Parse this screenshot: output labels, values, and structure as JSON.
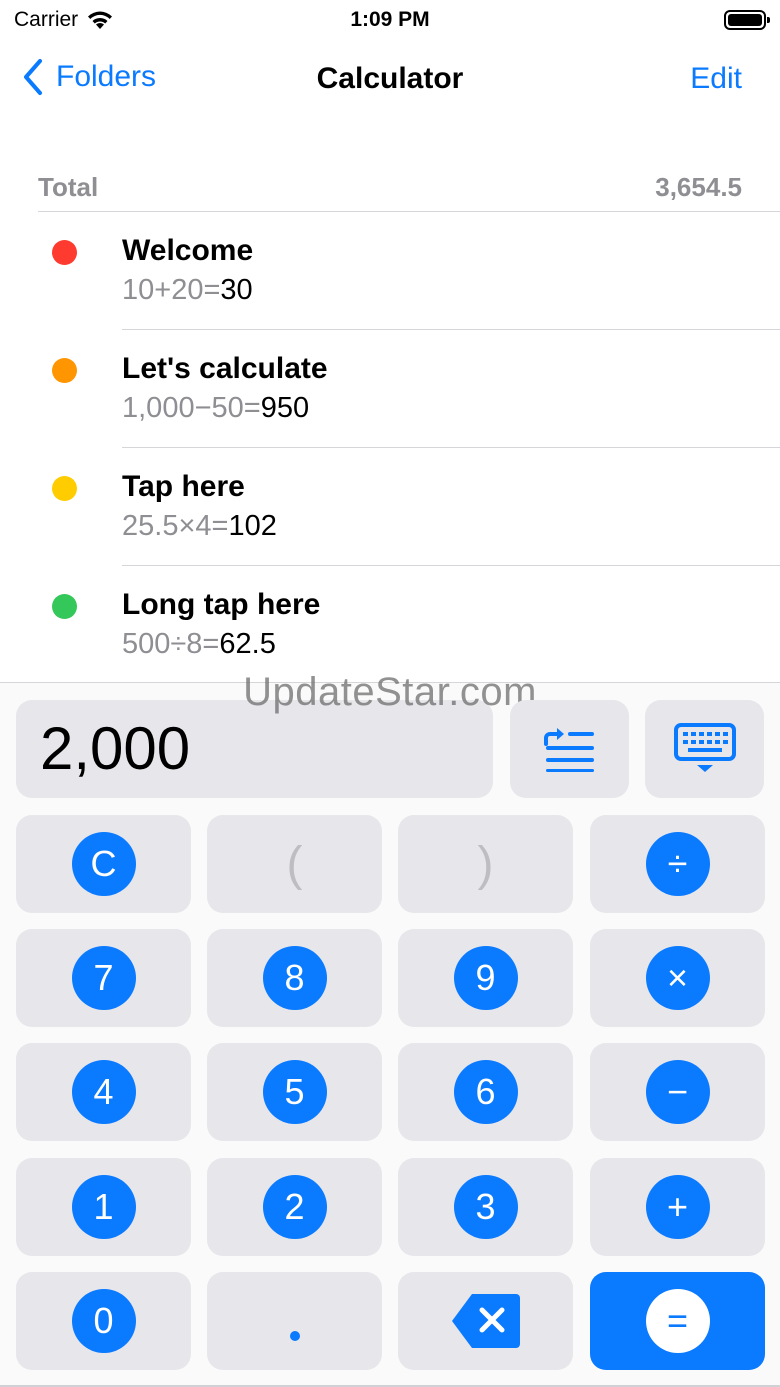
{
  "status": {
    "carrier": "Carrier",
    "time": "1:09 PM"
  },
  "nav": {
    "back_label": "Folders",
    "title": "Calculator",
    "edit_label": "Edit"
  },
  "total": {
    "label": "Total",
    "value": "3,654.5"
  },
  "items": [
    {
      "title": "Welcome",
      "expr": "10+20=",
      "result": "30",
      "color": "#ff3b30"
    },
    {
      "title": "Let's calculate",
      "expr": "1,000−50=",
      "result": "950",
      "color": "#ff9500"
    },
    {
      "title": "Tap here",
      "expr": "25.5×4=",
      "result": "102",
      "color": "#ffcc00"
    },
    {
      "title": "Long tap here",
      "expr": "500÷8=",
      "result": "62.5",
      "color": "#34c759"
    }
  ],
  "watermark": "UpdateStar.com",
  "display": {
    "value": "2,000"
  },
  "keys": {
    "clear": "C",
    "open_paren": "(",
    "close_paren": ")",
    "divide": "÷",
    "multiply": "×",
    "minus": "−",
    "plus": "+",
    "equals": "=",
    "seven": "7",
    "eight": "8",
    "nine": "9",
    "four": "4",
    "five": "5",
    "six": "6",
    "one": "1",
    "two": "2",
    "three": "3",
    "zero": "0"
  },
  "icons": {
    "back": "chevron-left-icon",
    "insert_result": "insert-result-icon",
    "keyboard": "keyboard-icon",
    "backspace": "backspace-icon"
  },
  "colors": {
    "accent": "#0a7aff",
    "key_bg": "#e6e6eb",
    "secondary_text": "#8e8e93"
  }
}
